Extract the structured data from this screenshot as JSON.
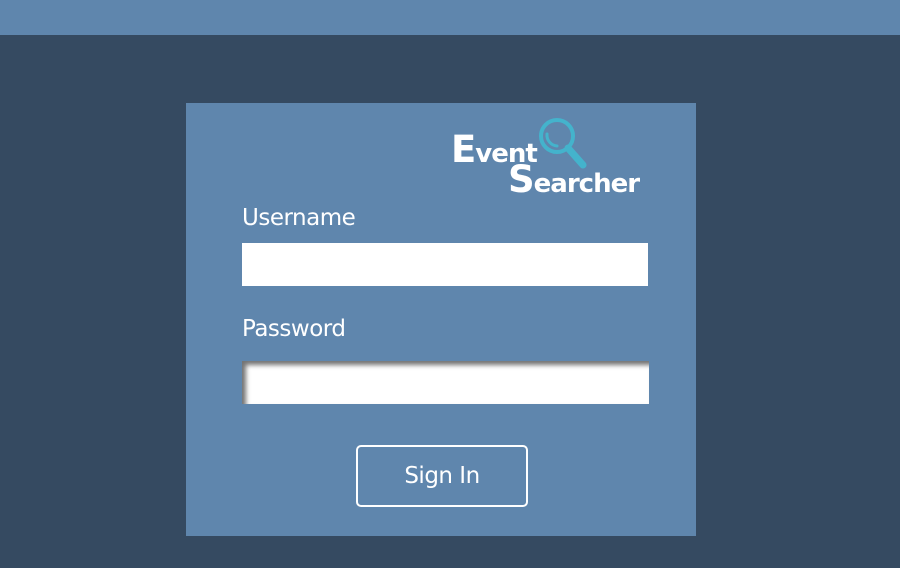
{
  "colors": {
    "background": "#354a61",
    "panel": "#5f86ad",
    "accent": "#44b3cc",
    "text": "#ffffff"
  },
  "logo": {
    "line1_cap": "E",
    "line1_rest": "vent",
    "line2_cap": "S",
    "line2_rest": "earcher",
    "icon": "magnifier-icon"
  },
  "form": {
    "username_label": "Username",
    "username_value": "",
    "password_label": "Password",
    "password_value": "",
    "submit_label": "Sign In"
  }
}
